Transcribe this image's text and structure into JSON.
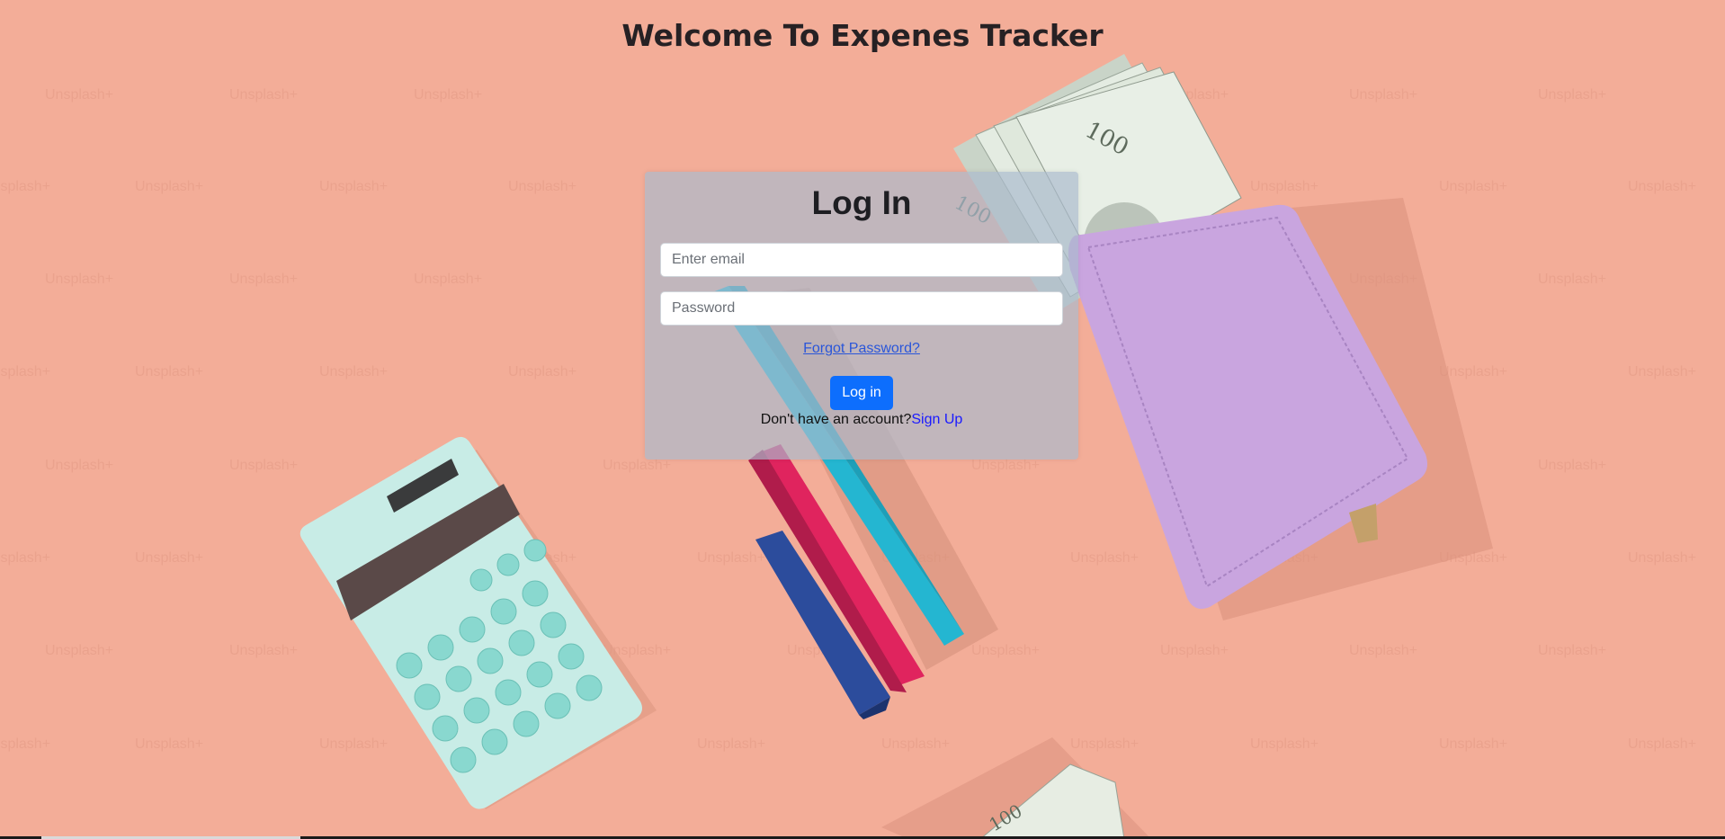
{
  "page": {
    "title": "Welcome To Expenes Tracker"
  },
  "login": {
    "heading": "Log In",
    "email_placeholder": "Enter email",
    "password_placeholder": "Password",
    "forgot_label": "Forgot Password?",
    "submit_label": "Log in",
    "signup_prompt": "Don't have an account?",
    "signup_label": "Sign Up"
  },
  "background": {
    "watermark_text": "Unsplash+"
  },
  "colors": {
    "background": "#f3ad98",
    "primary_button": "#0d6efd",
    "link": "#2a56d9",
    "card": "#aab9cd"
  },
  "icons": [
    "calculator-icon",
    "wallet-icon",
    "banknote-icon",
    "bar-blocks-icon"
  ]
}
